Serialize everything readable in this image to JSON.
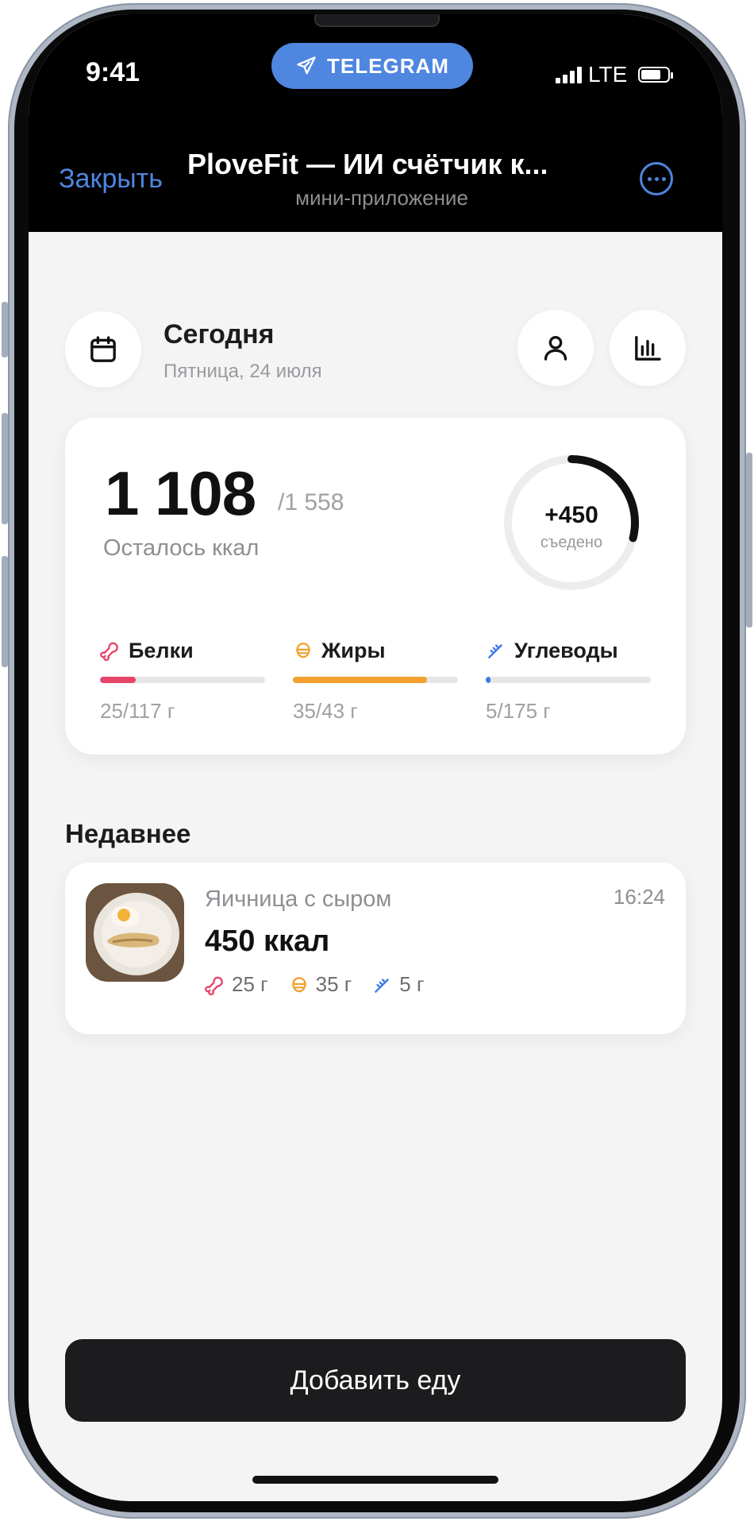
{
  "status_bar": {
    "time": "9:41",
    "pill_label": "TELEGRAM",
    "network": "LTE"
  },
  "header": {
    "close_label": "Закрыть",
    "title": "PloveFit — ИИ счётчик к...",
    "subtitle": "мини-приложение",
    "more_icon": "ellipsis-circle-icon"
  },
  "date_row": {
    "title": "Сегодня",
    "subtitle": "Пятница, 24 июля",
    "calendar_icon": "calendar-icon",
    "profile_icon": "person-icon",
    "stats_icon": "bar-chart-icon"
  },
  "summary": {
    "remaining": "1 108",
    "goal": "/1 558",
    "remaining_label": "Осталось ккал",
    "eaten": "+450",
    "eaten_label": "съедено",
    "eaten_fraction": 0.289,
    "macros": [
      {
        "key": "protein",
        "label": "Белки",
        "value": "25/117 г",
        "fraction": 0.214,
        "color": "#e8456b",
        "icon": "protein-icon"
      },
      {
        "key": "fat",
        "label": "Жиры",
        "value": "35/43 г",
        "fraction": 0.814,
        "color": "#f2a12e",
        "icon": "fat-icon"
      },
      {
        "key": "carbs",
        "label": "Углеводы",
        "value": "5/175 г",
        "fraction": 0.029,
        "color": "#3d7be6",
        "icon": "carbs-icon"
      }
    ]
  },
  "recent": {
    "title": "Недавнее",
    "items": [
      {
        "name": "Яичница с сыром",
        "time": "16:24",
        "kcal": "450 ккал",
        "protein": "25 г",
        "fat": "35 г",
        "carbs": "5 г",
        "image": "fried-eggs-photo"
      }
    ]
  },
  "footer": {
    "add_label": "Добавить еду"
  },
  "colors": {
    "accent_blue": "#4e86e0",
    "protein": "#e8456b",
    "fat": "#f2a12e",
    "carbs": "#3d7be6",
    "button_dark": "#1c1c1e"
  }
}
